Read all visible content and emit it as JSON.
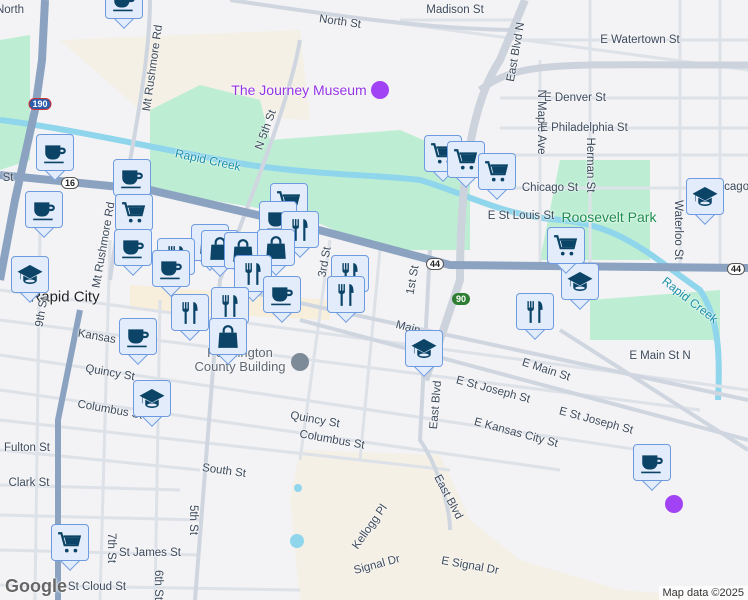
{
  "labels": {
    "north_st": "North St",
    "madison_st": "Madison St",
    "watertown": "E Watertown St",
    "rushmore1": "Mt Rushmore Rd",
    "journey": "The Journey Museum",
    "n5th": "N 5th St",
    "creek1": "Rapid Creek",
    "denver": "E Denver St",
    "maple": "N Maple Ave",
    "philadelphia": "E Philadelphia St",
    "herman": "Herman St",
    "eastblvdn": "East Blvd N",
    "chicago": "Chicago St",
    "chicago2": "Chicago",
    "stlouis": "E St Louis St",
    "roosevelt": "Roosevelt Park",
    "waterloo": "Waterloo St",
    "city": "Rapid City",
    "rushmore2": "Mt Rushmore Rd",
    "third": "3rd St",
    "first": "1st St",
    "ninth": "9th St",
    "kansas": "Kansas City St",
    "county1": "Pennington",
    "county2": "County Building",
    "quincy1": "Quincy St",
    "columbus1": "Columbus St",
    "fulton": "Fulton St",
    "clark": "Clark St",
    "south": "South St",
    "quincy2": "Quincy St",
    "columbus2": "Columbus St",
    "fifth": "5th St",
    "seventh": "7th St",
    "stjames": "St James St",
    "sixth": "6th St",
    "stcloud": "St Cloud St",
    "kellogg": "Kellogg Pl",
    "signal": "Signal Dr",
    "esignal": "E Signal Dr",
    "eastblvd1": "East Blvd",
    "eastblvd2": "East Blvd",
    "emain": "E Main St",
    "stjoseph1": "E St Joseph St",
    "stjoseph2": "E St Joseph St",
    "ekansas": "E Kansas City St",
    "emainn": "E Main St N",
    "creek2": "Rapid Creek",
    "main": "Main",
    "st_left": "St",
    "north_partial": "North"
  },
  "shields": {
    "i190": "190",
    "us16": "16",
    "sd44a": "44",
    "sd44b": "44",
    "i90": "90"
  },
  "footer": {
    "attribution": "Map data ©2025",
    "logo": "Google"
  },
  "colors": {
    "marker_bg": "#e3ecfb",
    "marker_border": "#6e9be0",
    "icon": "#0b4467",
    "park": "#bdeed3",
    "water": "#8fd6ec",
    "highway": "#8ba3c1"
  }
}
